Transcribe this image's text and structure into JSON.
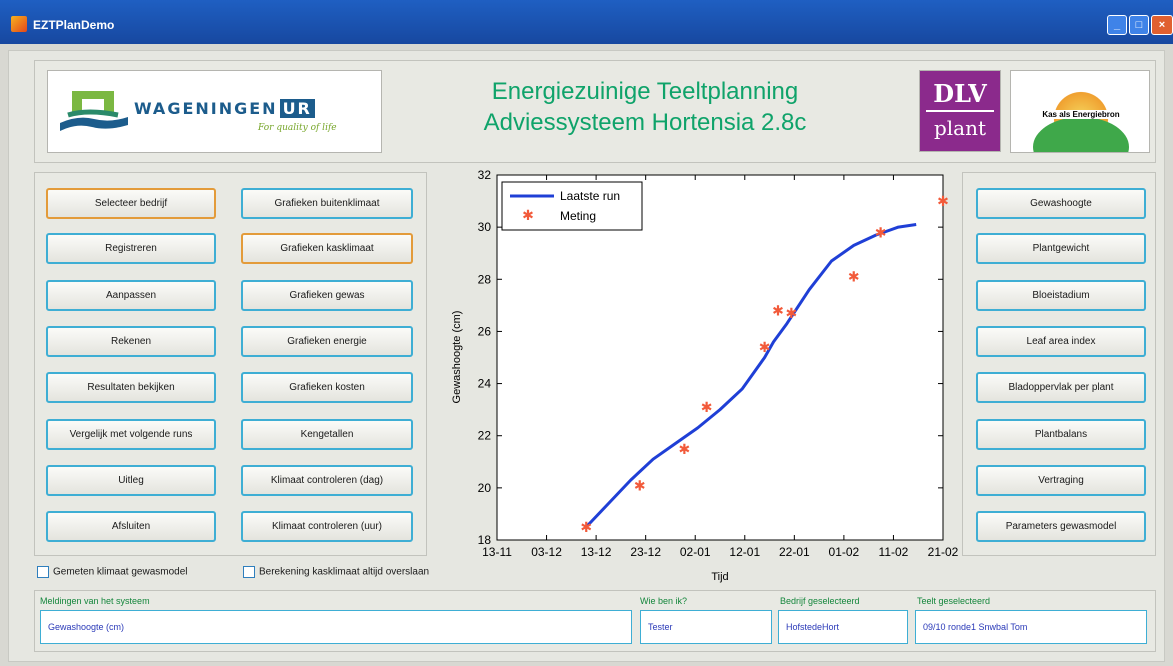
{
  "window": {
    "title": "EZTPlanDemo"
  },
  "header": {
    "title_line1": "Energiezuinige Teeltplanning",
    "title_line2": "Adviessysteem Hortensia 2.8c",
    "wur_logo_text": "WAGENINGEN",
    "wur_logo_ur": "UR",
    "wur_tagline": "For quality of life",
    "dlv_line1": "DLV",
    "dlv_line2": "plant",
    "kas_logo_text": "Kas als Energiebron"
  },
  "left_buttons": [
    "Selecteer bedrijf",
    "Registreren",
    "Aanpassen",
    "Rekenen",
    "Resultaten bekijken",
    "Vergelijk  met volgende runs",
    "Uitleg",
    "Afsluiten"
  ],
  "mid_buttons": [
    "Grafieken buitenklimaat",
    "Grafieken kasklimaat",
    "Grafieken gewas",
    "Grafieken energie",
    "Grafieken kosten",
    "Kengetallen",
    "Klimaat controleren (dag)",
    "Klimaat controleren (uur)"
  ],
  "right_buttons": [
    "Gewashoogte",
    "Plantgewicht",
    "Bloeistadium",
    "Leaf area index",
    "Bladoppervlak per plant",
    "Plantbalans",
    "Vertraging",
    "Parameters gewasmodel"
  ],
  "checkboxes": {
    "gemeten": "Gemeten klimaat gewasmodel",
    "berekening": "Berekening kasklimaat altijd overslaan"
  },
  "status": {
    "messages_label": "Meldingen van het systeem",
    "messages_value": "Gewashoogte (cm)",
    "who_label": "Wie ben ik?",
    "who_value": "Tester",
    "company_label": "Bedrijf geselecteerd",
    "company_value": "HofstedeHort",
    "crop_label": "Teelt geselecteerd",
    "crop_value": "09/10 ronde1 Snwbal Tom"
  },
  "chart_data": {
    "type": "line",
    "xlabel": "Tijd",
    "ylabel": "Gewashoogte (cm)",
    "x_ticks": [
      "13-11",
      "03-12",
      "13-12",
      "23-12",
      "02-01",
      "12-01",
      "22-01",
      "01-02",
      "11-02",
      "21-02"
    ],
    "xlim": [
      0,
      100
    ],
    "ylim": [
      18,
      32
    ],
    "y_ticks": [
      18,
      20,
      22,
      24,
      26,
      28,
      30,
      32
    ],
    "grid": false,
    "legend_position": "top-left",
    "series": [
      {
        "name": "Laatste run",
        "style": "line",
        "color": "#1f3fd6",
        "x": [
          20,
          25,
          30,
          35,
          40,
          45,
          50,
          55,
          60,
          62,
          65,
          70,
          75,
          80,
          85,
          90,
          94
        ],
        "y": [
          18.5,
          19.4,
          20.3,
          21.1,
          21.7,
          22.3,
          23.0,
          23.8,
          25.0,
          25.6,
          26.3,
          27.6,
          28.7,
          29.3,
          29.7,
          30.0,
          30.1
        ]
      },
      {
        "name": "Meting",
        "style": "marker",
        "color": "#f25a3a",
        "x": [
          20,
          32,
          42,
          47,
          60,
          63,
          66,
          80,
          86,
          100
        ],
        "y": [
          18.5,
          20.1,
          21.5,
          23.1,
          25.4,
          26.8,
          26.7,
          28.1,
          29.8,
          31.0
        ]
      }
    ]
  }
}
